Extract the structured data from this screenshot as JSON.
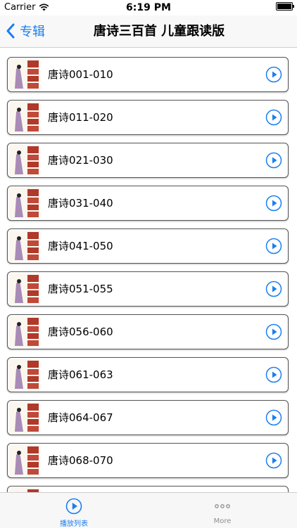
{
  "status": {
    "carrier": "Carrier",
    "time": "6:19 PM"
  },
  "nav": {
    "back_label": "专辑",
    "title": "唐诗三百首 儿童跟读版"
  },
  "list": {
    "items": [
      {
        "label": "唐诗001-010"
      },
      {
        "label": "唐诗011-020"
      },
      {
        "label": "唐诗021-030"
      },
      {
        "label": "唐诗031-040"
      },
      {
        "label": "唐诗041-050"
      },
      {
        "label": "唐诗051-055"
      },
      {
        "label": "唐诗056-060"
      },
      {
        "label": "唐诗061-063"
      },
      {
        "label": "唐诗064-067"
      },
      {
        "label": "唐诗068-070"
      },
      {
        "label": ""
      }
    ]
  },
  "tabs": [
    {
      "label": "播放列表",
      "icon": "play-circle-icon",
      "active": true
    },
    {
      "label": "More",
      "icon": "more-dots-icon",
      "active": false
    }
  ],
  "colors": {
    "accent": "#1a7ef0",
    "inactive": "#8e8e93"
  }
}
